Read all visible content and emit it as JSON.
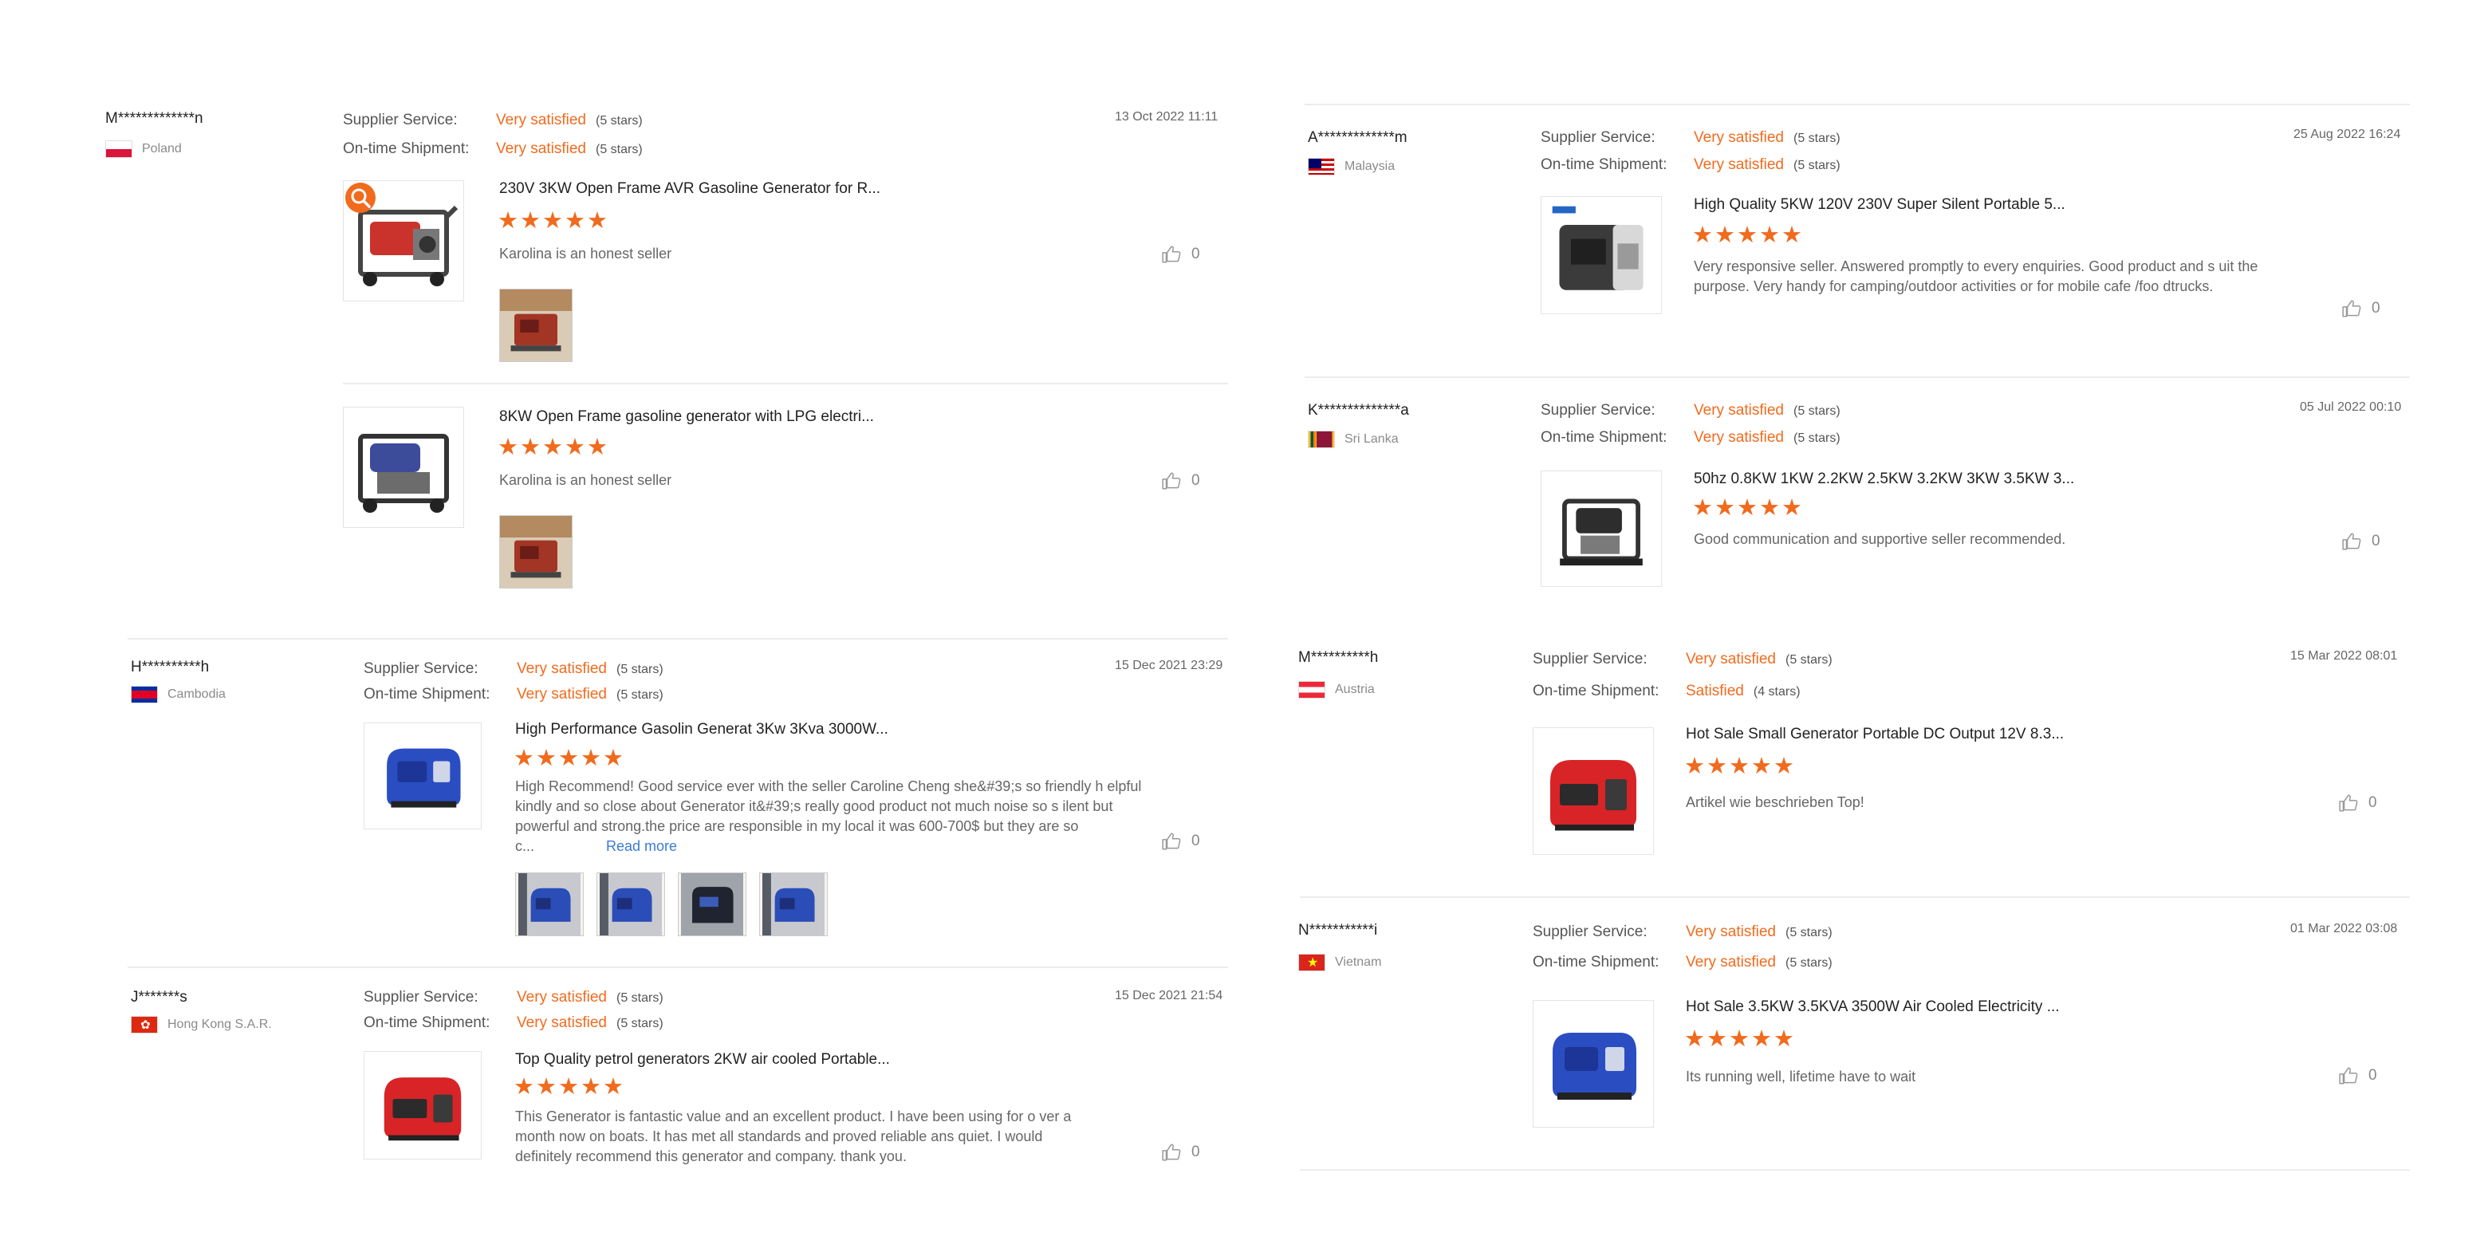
{
  "labels": {
    "supplier_service": "Supplier Service:",
    "ontime_shipment": "On-time Shipment:"
  },
  "left": [
    {
      "user": "M*************n",
      "country": "Poland",
      "date": "13 Oct 2022 11:11",
      "supplier_service": {
        "value": "Very satisfied",
        "stars": "(5 stars)"
      },
      "ontime_shipment": {
        "value": "Very satisfied",
        "stars": "(5 stars)"
      },
      "products": [
        {
          "title": "230V 3KW Open Frame AVR Gasoline Generator for R...",
          "rating": "★★★★★",
          "text": "Karolina is an honest seller",
          "likes": "0"
        },
        {
          "title": "8KW Open Frame gasoline generator with LPG electri...",
          "rating": "★★★★★",
          "text": "Karolina is an honest seller",
          "likes": "0"
        }
      ]
    },
    {
      "user": "H**********h",
      "country": "Cambodia",
      "date": "15 Dec 2021 23:29",
      "supplier_service": {
        "value": "Very satisfied",
        "stars": "(5 stars)"
      },
      "ontime_shipment": {
        "value": "Very satisfied",
        "stars": "(5 stars)"
      },
      "products": [
        {
          "title": "High Performance Gasolin Generat 3Kw 3Kva 3000W...",
          "rating": "★★★★★",
          "text": "High Recommend! Good service ever with the seller Caroline Cheng she&#39;s so friendly h elpful kindly and so close about Generator it&#39;s really good product not much noise so s ilent but powerful and strong.the price are responsible in my local it was 600-700$ but they are so c...",
          "read_more": "Read more",
          "likes": "0"
        }
      ]
    },
    {
      "user": "J*******s",
      "country": "Hong Kong S.A.R.",
      "date": "15 Dec 2021 21:54",
      "supplier_service": {
        "value": "Very satisfied",
        "stars": "(5 stars)"
      },
      "ontime_shipment": {
        "value": "Very satisfied",
        "stars": "(5 stars)"
      },
      "products": [
        {
          "title": "Top Quality petrol generators 2KW air cooled Portable...",
          "rating": "★★★★★",
          "text": "This Generator is fantastic value and an excellent product. I have been using for o ver a month now on boats. It has met all standards and proved reliable ans quiet. I would definitely recommend this generator and company. thank you.",
          "likes": "0"
        }
      ]
    }
  ],
  "right": [
    {
      "user": "A*************m",
      "country": "Malaysia",
      "date": "25 Aug 2022 16:24",
      "supplier_service": {
        "value": "Very satisfied",
        "stars": "(5 stars)"
      },
      "ontime_shipment": {
        "value": "Very satisfied",
        "stars": "(5 stars)"
      },
      "products": [
        {
          "title": "High Quality 5KW 120V 230V Super Silent Portable 5...",
          "rating": "★★★★★",
          "text": "Very responsive seller. Answered promptly to every enquiries. Good product and s uit the purpose. Very handy for camping/outdoor activities or for mobile cafe /foo dtrucks.",
          "likes": "0"
        }
      ]
    },
    {
      "user": "K**************a",
      "country": "Sri Lanka",
      "date": "05 Jul 2022 00:10",
      "supplier_service": {
        "value": "Very satisfied",
        "stars": "(5 stars)"
      },
      "ontime_shipment": {
        "value": "Very satisfied",
        "stars": "(5 stars)"
      },
      "products": [
        {
          "title": "50hz 0.8KW 1KW 2.2KW 2.5KW 3.2KW 3KW 3.5KW 3...",
          "rating": "★★★★★",
          "text": "Good communication and supportive seller recommended.",
          "likes": "0"
        }
      ]
    },
    {
      "user": "M**********h",
      "country": "Austria",
      "date": "15 Mar 2022 08:01",
      "supplier_service": {
        "value": "Very satisfied",
        "stars": "(5 stars)"
      },
      "ontime_shipment": {
        "value": "Satisfied",
        "stars": "(4 stars)"
      },
      "products": [
        {
          "title": "Hot Sale Small Generator Portable DC Output 12V 8.3...",
          "rating": "★★★★★",
          "text": "Artikel wie beschrieben Top!",
          "likes": "0"
        }
      ]
    },
    {
      "user": "N***********i",
      "country": "Vietnam",
      "date": "01 Mar 2022 03:08",
      "supplier_service": {
        "value": "Very satisfied",
        "stars": "(5 stars)"
      },
      "ontime_shipment": {
        "value": "Very satisfied",
        "stars": "(5 stars)"
      },
      "products": [
        {
          "title": "Hot Sale 3.5KW 3.5KVA 3500W Air Cooled Electricity ...",
          "rating": "★★★★★",
          "text": "Its running well, lifetime have to wait",
          "likes": "0"
        }
      ]
    }
  ]
}
